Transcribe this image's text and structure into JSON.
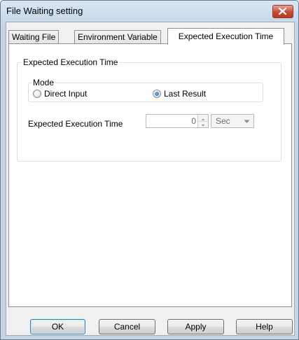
{
  "window": {
    "title": "File Waiting setting"
  },
  "tabs": [
    {
      "label": "Waiting File"
    },
    {
      "label": "Environment Variable"
    },
    {
      "label": "Expected Execution Time"
    }
  ],
  "panel": {
    "group_title": "Expected Execution Time",
    "mode": {
      "title": "Mode",
      "options": [
        {
          "label": "Direct Input",
          "checked": false
        },
        {
          "label": "Last Result",
          "checked": true
        }
      ]
    },
    "time_field": {
      "label": "Expected Execution Time",
      "value": "0",
      "unit": "Sec"
    }
  },
  "buttons": {
    "ok": "OK",
    "cancel": "Cancel",
    "apply": "Apply",
    "help": "Help"
  },
  "colors": {
    "close_button": "#c7492f",
    "titlebar": "#d9e6f3"
  }
}
